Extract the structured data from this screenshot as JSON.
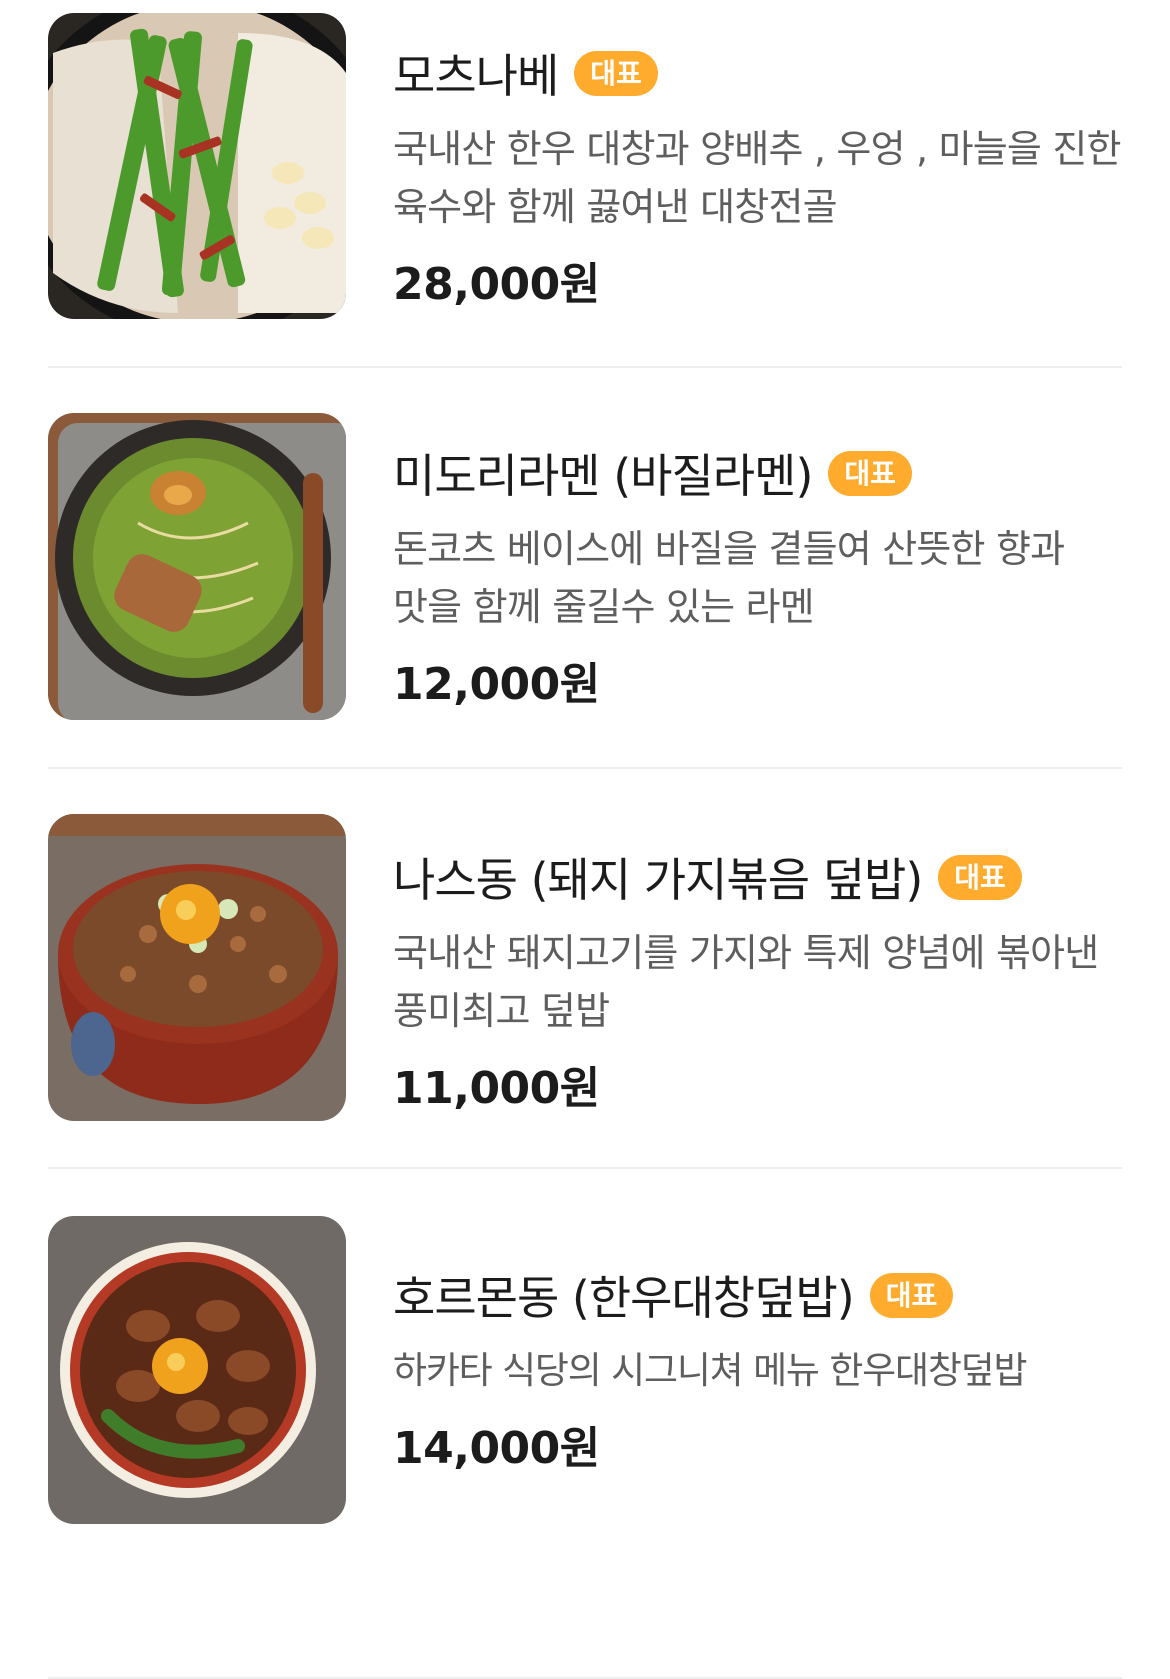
{
  "menu": {
    "items": [
      {
        "name": "모츠나베",
        "badge": "대표",
        "description": "국내산 한우 대창과 양배추 , 우엉 , 마늘을 진한 육수와 함께 끓여낸 대창전골",
        "price": "28,000원",
        "image_icon": "hotpot-icon"
      },
      {
        "name": "미도리라멘 (바질라멘)",
        "badge": "대표",
        "description": "돈코츠 베이스에 바질을 곁들여 산뜻한 향과 맛을 함께 줄길수 있는 라멘",
        "price": "12,000원",
        "image_icon": "ramen-icon"
      },
      {
        "name": "나스동 (돼지 가지볶음 덮밥)",
        "badge": "대표",
        "description": "국내산 돼지고기를 가지와 특제 양념에 볶아낸 풍미최고 덮밥",
        "price": "11,000원",
        "image_icon": "rice-bowl-icon"
      },
      {
        "name": "호르몬동 (한우대창덮밥)",
        "badge": "대표",
        "description": "하카타 식당의 시그니쳐 메뉴 한우대창덮밥",
        "price": "14,000원",
        "image_icon": "rice-bowl-icon"
      }
    ]
  },
  "colors": {
    "badge": "#ffab2d",
    "title": "#1c1c1c",
    "description": "#5e5e5e",
    "divider": "#efefef"
  }
}
